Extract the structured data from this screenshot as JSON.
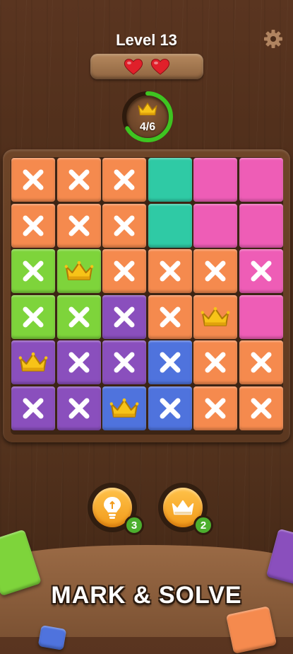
{
  "header": {
    "level_title": "Level 13",
    "lives": 2,
    "settings_icon": "gear-icon"
  },
  "progress": {
    "label": "4/6",
    "fraction": 0.667,
    "icon": "crown-icon",
    "ring_color": "#3ec421"
  },
  "board": {
    "rows": 6,
    "cols": 6,
    "colors": {
      "orange": "#f58a4e",
      "teal": "#2fcaa5",
      "pink": "#ee5db6",
      "green": "#7ed43b",
      "purple": "#8a4fbd",
      "blue": "#4f73dd"
    },
    "cells": [
      [
        {
          "c": "orange",
          "m": "x"
        },
        {
          "c": "orange",
          "m": "x"
        },
        {
          "c": "orange",
          "m": "x"
        },
        {
          "c": "teal",
          "m": ""
        },
        {
          "c": "pink",
          "m": ""
        },
        {
          "c": "pink",
          "m": ""
        }
      ],
      [
        {
          "c": "orange",
          "m": "x"
        },
        {
          "c": "orange",
          "m": "x"
        },
        {
          "c": "orange",
          "m": "x"
        },
        {
          "c": "teal",
          "m": ""
        },
        {
          "c": "pink",
          "m": ""
        },
        {
          "c": "pink",
          "m": ""
        }
      ],
      [
        {
          "c": "green",
          "m": "x"
        },
        {
          "c": "green",
          "m": "crown"
        },
        {
          "c": "orange",
          "m": "x"
        },
        {
          "c": "orange",
          "m": "x"
        },
        {
          "c": "orange",
          "m": "x"
        },
        {
          "c": "pink",
          "m": "x"
        }
      ],
      [
        {
          "c": "green",
          "m": "x"
        },
        {
          "c": "green",
          "m": "x"
        },
        {
          "c": "purple",
          "m": "x"
        },
        {
          "c": "orange",
          "m": "x"
        },
        {
          "c": "orange",
          "m": "crown"
        },
        {
          "c": "pink",
          "m": ""
        }
      ],
      [
        {
          "c": "purple",
          "m": "crown"
        },
        {
          "c": "purple",
          "m": "x"
        },
        {
          "c": "purple",
          "m": "x"
        },
        {
          "c": "blue",
          "m": "x"
        },
        {
          "c": "orange",
          "m": "x"
        },
        {
          "c": "orange",
          "m": "x"
        }
      ],
      [
        {
          "c": "purple",
          "m": "x"
        },
        {
          "c": "purple",
          "m": "x"
        },
        {
          "c": "blue",
          "m": "crown"
        },
        {
          "c": "blue",
          "m": "x"
        },
        {
          "c": "orange",
          "m": "x"
        },
        {
          "c": "orange",
          "m": "x"
        }
      ]
    ]
  },
  "powerups": {
    "hint": {
      "icon": "lightbulb-icon",
      "count": "3"
    },
    "crown": {
      "icon": "crown-icon",
      "count": "2"
    }
  },
  "slogan": "MARK & SOLVE"
}
